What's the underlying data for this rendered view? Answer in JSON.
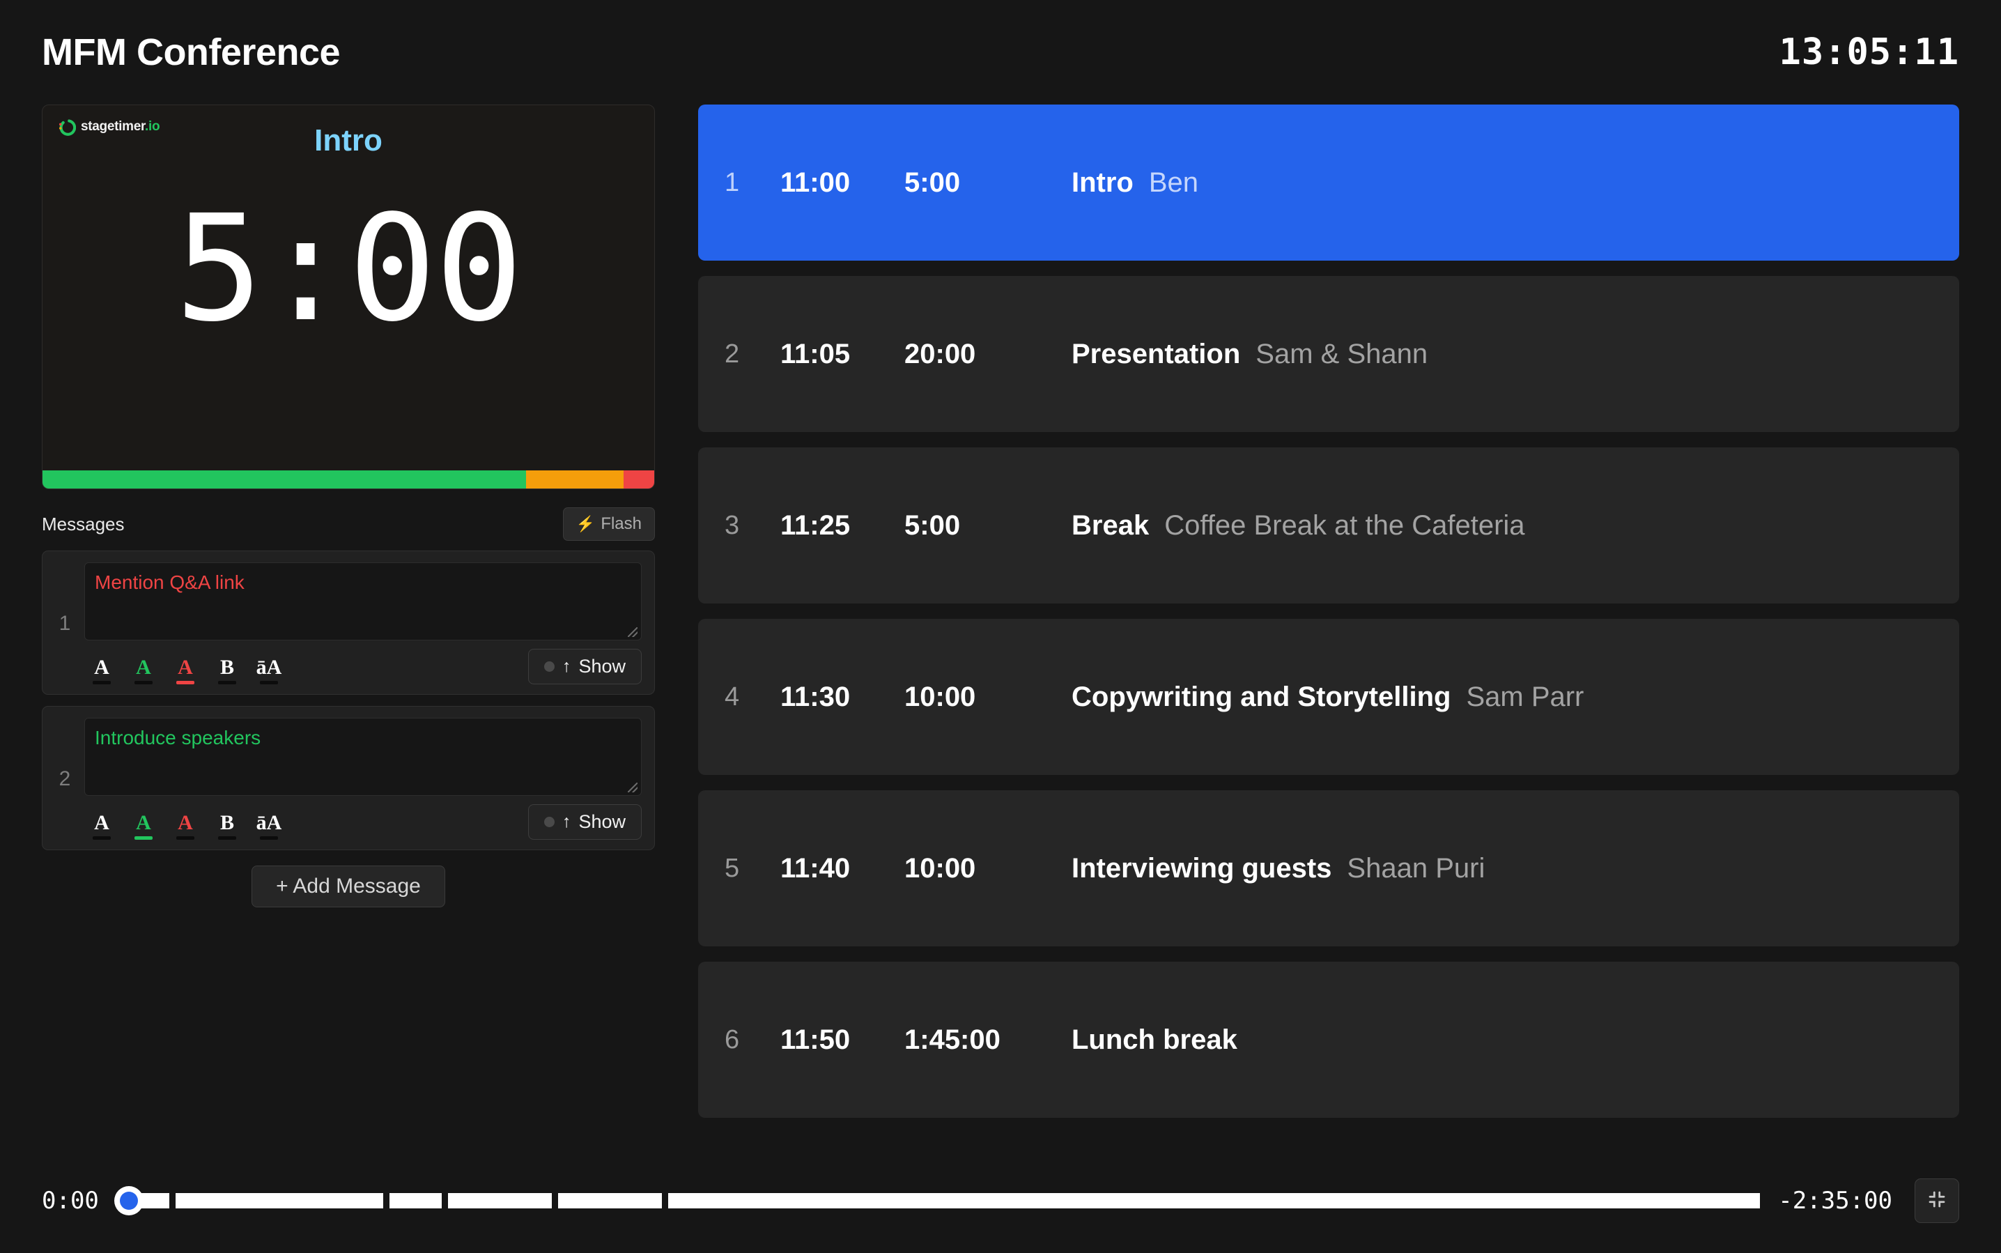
{
  "header": {
    "room_title": "MFM Conference",
    "clock": "13:05:11"
  },
  "viewer": {
    "logo_text": "stagetimer",
    "logo_tld": ".io",
    "title": "Intro",
    "time": "5:00",
    "progress": [
      {
        "color": "#22c55e",
        "percent": 79
      },
      {
        "color": "#f59e0b",
        "percent": 16
      },
      {
        "color": "#ef4444",
        "percent": 5
      }
    ]
  },
  "messages": {
    "label": "Messages",
    "flash_label": "Flash",
    "add_label": "+ Add Message",
    "format_buttons": [
      {
        "glyph": "A",
        "name": "color-white",
        "color": "#ffffff",
        "bar": "#0c0c0c"
      },
      {
        "glyph": "A",
        "name": "color-green",
        "color": "#22c55e",
        "bar": "#0c0c0c"
      },
      {
        "glyph": "A",
        "name": "color-red",
        "color": "#ef4444",
        "bar": "#0c0c0c"
      },
      {
        "glyph": "B",
        "name": "bold",
        "color": "#ffffff",
        "bar": "#0c0c0c"
      },
      {
        "glyph": "āA",
        "name": "capitalize",
        "color": "#ffffff",
        "bar": "#0c0c0c"
      }
    ],
    "items": [
      {
        "index": "1",
        "text": "Mention Q&A link",
        "color": "#ef4444",
        "active_format": 2,
        "show_label": "Show",
        "show_arrow": "↑"
      },
      {
        "index": "2",
        "text": "Introduce speakers",
        "color": "#22c55e",
        "active_format": 1,
        "show_label": "Show",
        "show_arrow": "↑"
      }
    ]
  },
  "agenda": {
    "rows": [
      {
        "index": "1",
        "start": "11:00",
        "duration": "5:00",
        "title": "Intro",
        "speaker": "Ben",
        "active": true
      },
      {
        "index": "2",
        "start": "11:05",
        "duration": "20:00",
        "title": "Presentation",
        "speaker": "Sam & Shann",
        "active": false
      },
      {
        "index": "3",
        "start": "11:25",
        "duration": "5:00",
        "title": "Break",
        "speaker": "Coffee Break at the Cafeteria",
        "active": false
      },
      {
        "index": "4",
        "start": "11:30",
        "duration": "10:00",
        "title": "Copywriting and Storytelling",
        "speaker": "Sam Parr",
        "active": false
      },
      {
        "index": "5",
        "start": "11:40",
        "duration": "10:00",
        "title": "Interviewing guests",
        "speaker": "Shaan Puri",
        "active": false
      },
      {
        "index": "6",
        "start": "11:50",
        "duration": "1:45:00",
        "title": "Lunch break",
        "speaker": "",
        "active": false
      }
    ]
  },
  "timeline": {
    "elapsed": "0:00",
    "remaining": "-2:35:00",
    "playhead_percent": 0,
    "segments": [
      {
        "flex": 5
      },
      {
        "flex": 20
      },
      {
        "flex": 5
      },
      {
        "flex": 10
      },
      {
        "flex": 10
      },
      {
        "flex": 105
      }
    ],
    "accent": "#2563eb"
  }
}
